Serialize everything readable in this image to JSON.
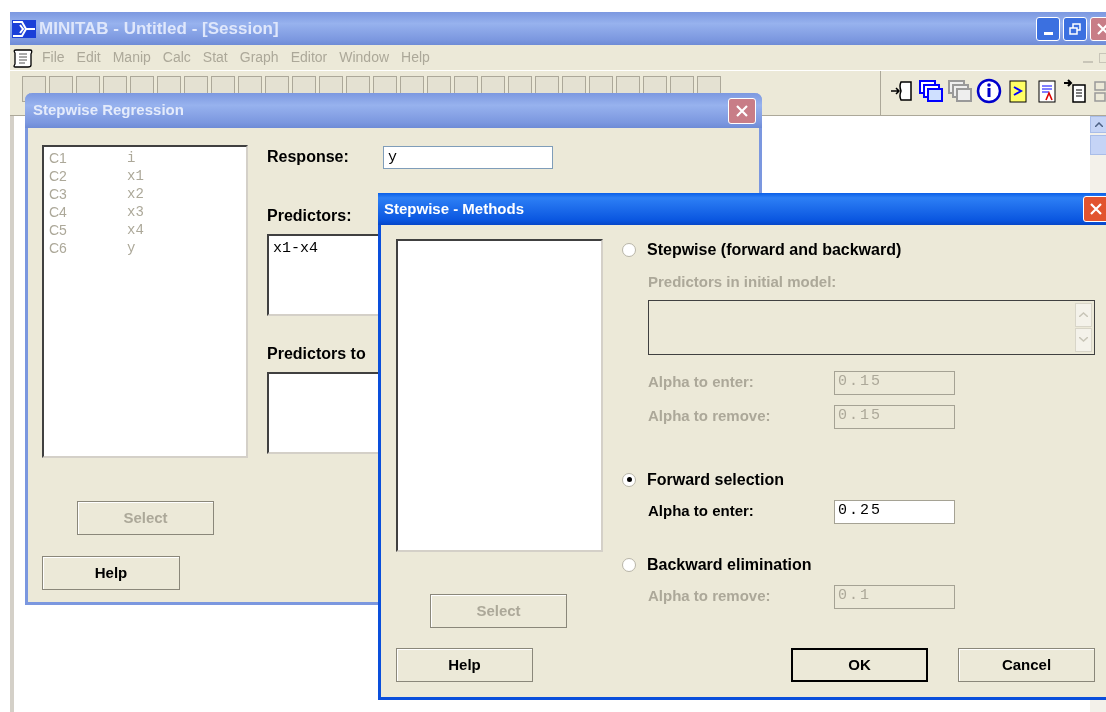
{
  "window": {
    "title": "MINITAB - Untitled - [Session]",
    "active": false
  },
  "menu": [
    {
      "label": "File",
      "disabled": true
    },
    {
      "label": "Edit",
      "disabled": true
    },
    {
      "label": "Manip",
      "disabled": true
    },
    {
      "label": "Calc",
      "disabled": true
    },
    {
      "label": "Stat",
      "disabled": true
    },
    {
      "label": "Graph",
      "disabled": true
    },
    {
      "label": "Editor",
      "disabled": true
    },
    {
      "label": "Window",
      "disabled": true
    },
    {
      "label": "Help",
      "disabled": true
    }
  ],
  "stepwise_regression": {
    "title": "Stepwise Regression",
    "active": false,
    "variables": [
      {
        "column": "C1",
        "name": "i"
      },
      {
        "column": "C2",
        "name": "x1"
      },
      {
        "column": "C3",
        "name": "x2"
      },
      {
        "column": "C4",
        "name": "x3"
      },
      {
        "column": "C5",
        "name": "x4"
      },
      {
        "column": "C6",
        "name": "y"
      }
    ],
    "response": {
      "label": "Response:",
      "value": "y"
    },
    "predictors": {
      "label": "Predictors:",
      "value": "x1-x4"
    },
    "predictors_to": {
      "label": "Predictors to"
    },
    "buttons": [
      {
        "label": "Select",
        "disabled": true
      },
      {
        "label": "Help",
        "disabled": false
      }
    ]
  },
  "methods_dialog": {
    "title": "Stepwise - Methods",
    "active": true,
    "methods": [
      {
        "label": "Stepwise (forward and backward)",
        "selected": false,
        "initial_model": {
          "label": "Predictors in initial model:",
          "disabled": true
        },
        "fields": [
          {
            "label": "Alpha to enter:",
            "value": "0.15",
            "disabled": true
          },
          {
            "label": "Alpha to remove:",
            "value": "0.15",
            "disabled": true
          }
        ]
      },
      {
        "label": "Forward selection",
        "selected": true,
        "fields": [
          {
            "label": "Alpha to enter:",
            "value": "0.25",
            "disabled": false
          }
        ]
      },
      {
        "label": "Backward elimination",
        "selected": false,
        "fields": [
          {
            "label": "Alpha to remove:",
            "value": "0.1",
            "disabled": true
          }
        ]
      }
    ],
    "select_button": {
      "label": "Select",
      "disabled": true
    },
    "buttons": [
      {
        "label": "Help",
        "default": false
      },
      {
        "label": "OK",
        "default": true
      },
      {
        "label": "Cancel",
        "default": false
      }
    ]
  }
}
